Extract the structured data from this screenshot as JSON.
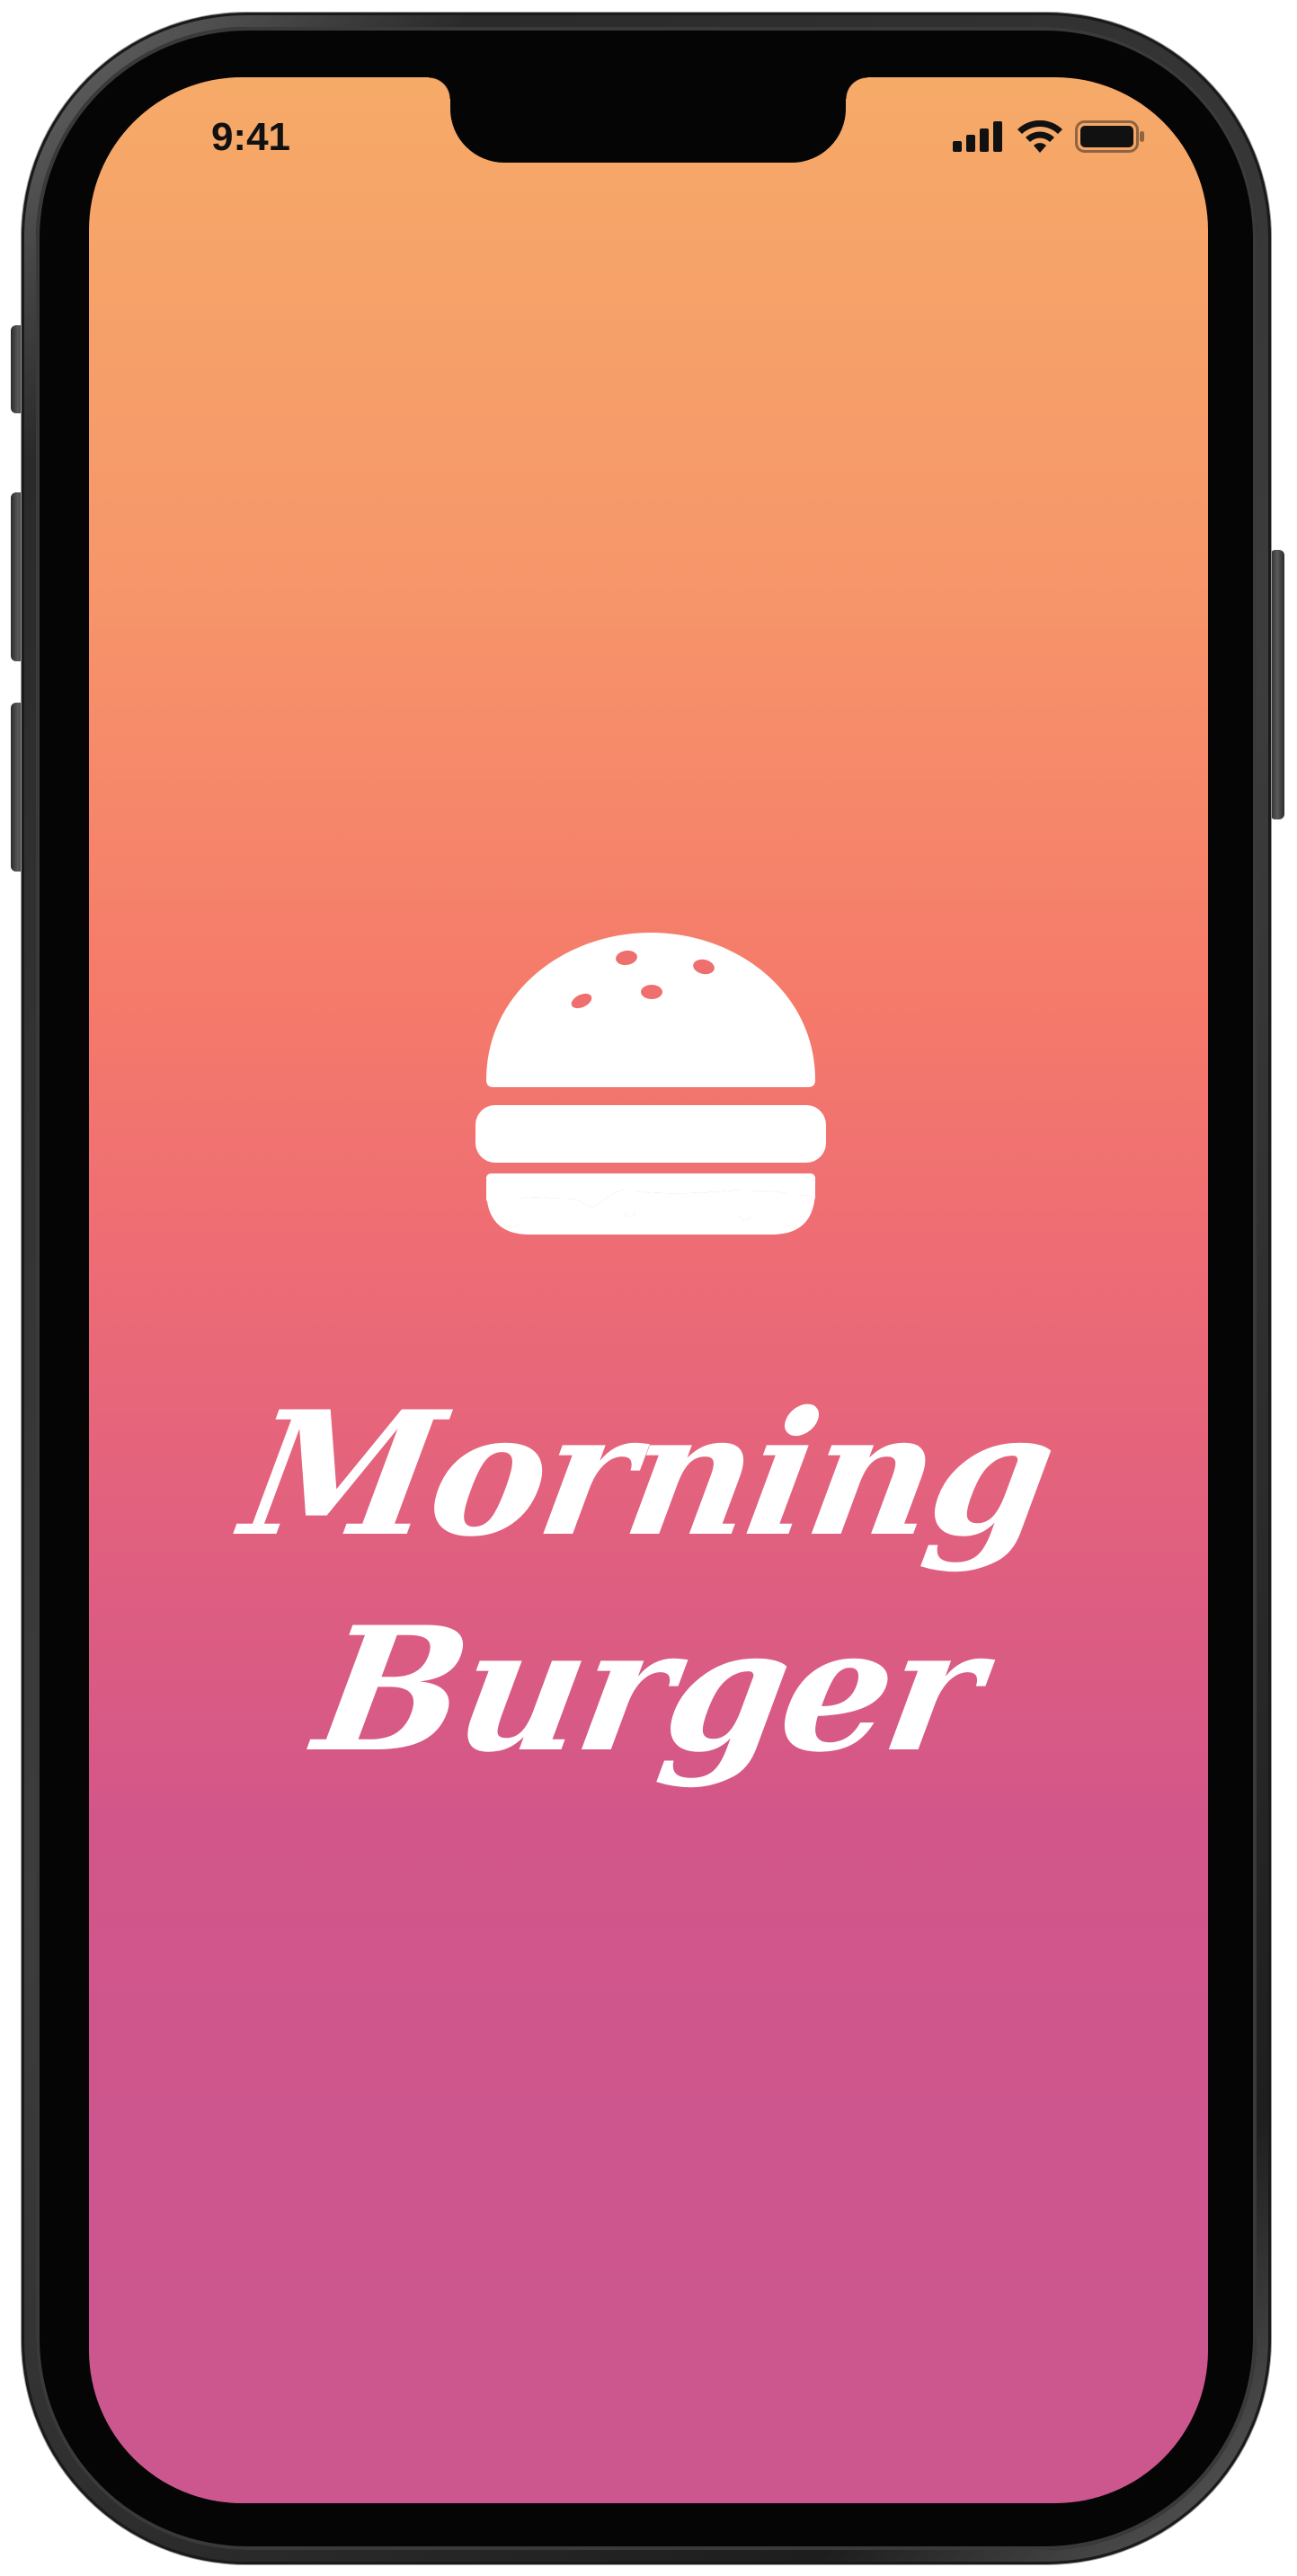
{
  "status_bar": {
    "time": "9:41",
    "signal_icon": "cellular-signal-icon",
    "wifi_icon": "wifi-icon",
    "battery_icon": "battery-icon"
  },
  "splash": {
    "logo_icon": "burger-icon",
    "title_line1": "Morning",
    "title_line2": "Burger"
  },
  "colors": {
    "gradient_top": "#f6aa68",
    "gradient_middle": "#f57a6a",
    "gradient_bottom": "#cc578f",
    "text": "#ffffff"
  }
}
